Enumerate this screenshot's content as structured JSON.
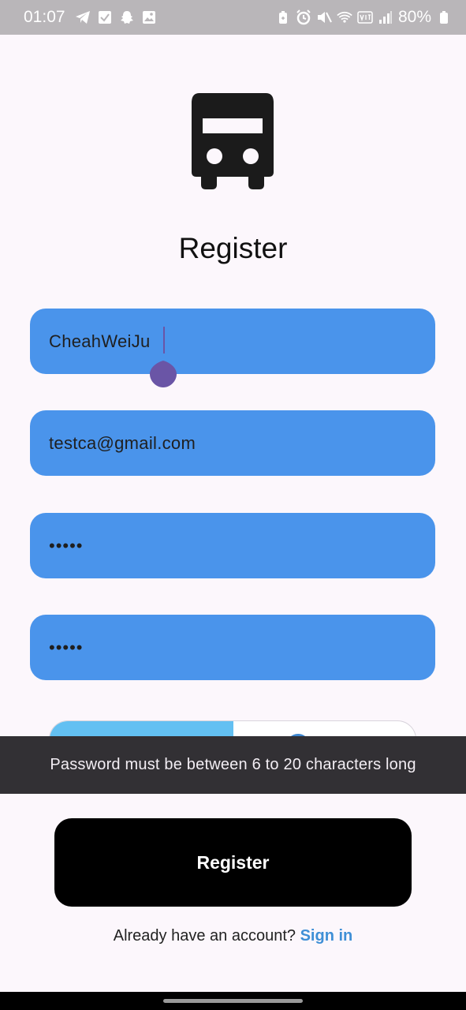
{
  "status_bar": {
    "time": "01:07",
    "battery_percent": "80%",
    "left_icons": [
      "telegram-icon",
      "check-box-icon",
      "snapchat-icon",
      "image-icon"
    ],
    "right_icons": [
      "battery-saver-icon",
      "alarm-icon",
      "mute-icon",
      "wifi-icon",
      "volte-icon",
      "signal-icon",
      "battery-icon"
    ]
  },
  "logo": {
    "icon": "bus-icon"
  },
  "title": "Register",
  "form": {
    "username_value": "CheahWeiJu",
    "email_value": "testca@gmail.com",
    "password_value": "•••••",
    "confirm_password_value": "•••••"
  },
  "snackbar": {
    "message": "Password must be between 6 to 20 characters long"
  },
  "register_button_label": "Register",
  "signin": {
    "prompt": "Already have an account?",
    "link": "Sign in"
  },
  "colors": {
    "field_bg": "#4a94eb",
    "button_bg": "#000000",
    "link": "#3f8fd6",
    "snackbar_bg": "#323034"
  }
}
